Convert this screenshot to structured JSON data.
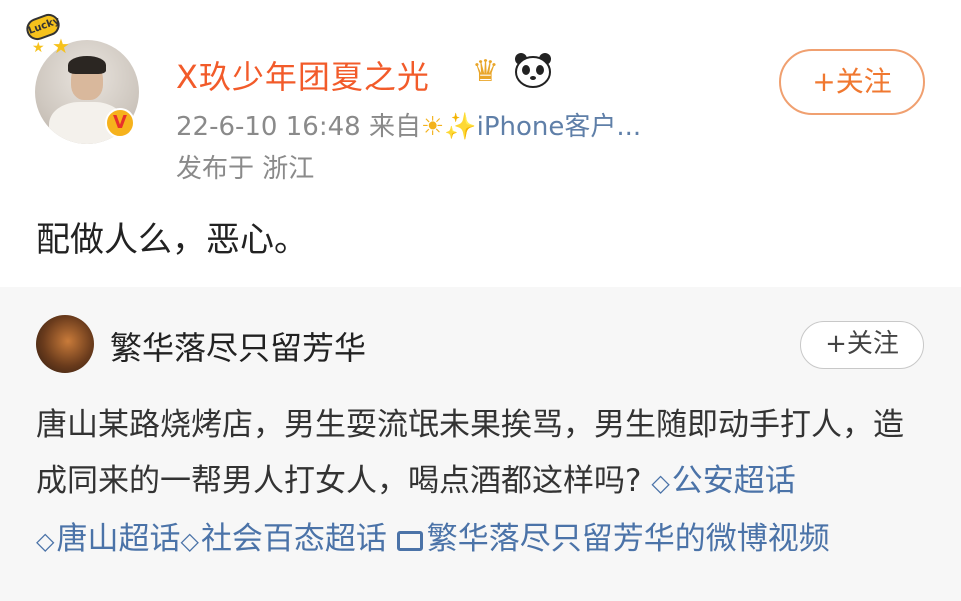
{
  "post": {
    "username": "X玖少年团夏之光",
    "timestamp": "22-6-10 16:48",
    "source_prefix": "来自",
    "source_name": "iPhone客户...",
    "location": "发布于 浙江",
    "follow_label": "+关注",
    "content": "配做人么，恶心。",
    "avatar_sticker_text": "Lucky"
  },
  "repost": {
    "username": "繁华落尽只留芳华",
    "follow_label": "+关注",
    "text": "唐山某路烧烤店，男生耍流氓未果挨骂，男生随即动手打人，造成同来的一帮男人打女人，喝点酒都这样吗?",
    "tags": [
      "公安超话",
      "唐山超话",
      "社会百态超话"
    ],
    "video_link": "繁华落尽只留芳华的微博视频"
  },
  "colors": {
    "username_orange": "#f25b2a",
    "follow_orange": "#f07830",
    "link_blue": "#4b73a8",
    "repost_bg": "#f7f7f7"
  }
}
